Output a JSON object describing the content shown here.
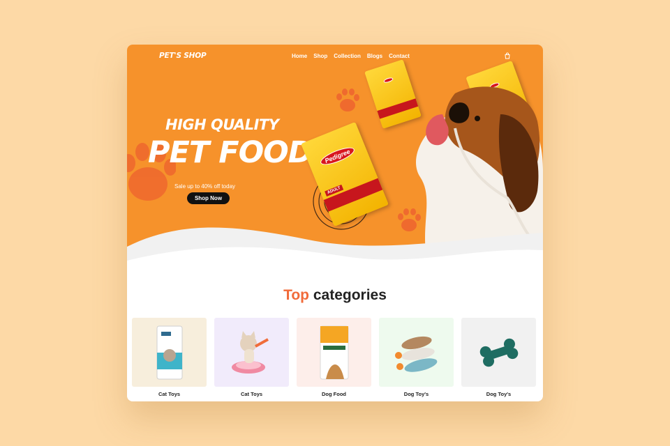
{
  "header": {
    "logo": "PET'S SHOP",
    "nav": [
      "Home",
      "Shop",
      "Collection",
      "Blogs",
      "Contact"
    ],
    "cart_icon": "bag-icon"
  },
  "hero": {
    "headline_top": "HIGH QUALITY",
    "headline_main": "PET FOOD",
    "subline": "Sale up to 40% off today",
    "cta": "Shop Now",
    "bag_brand": "Pedigree",
    "bag_label": "ADULT"
  },
  "categories": {
    "title_accent": "Top",
    "title_rest": "categories",
    "items": [
      {
        "label": "Cat Toys",
        "bg": "#f7eedc",
        "icon": "cat-food-bag"
      },
      {
        "label": "Cat Toys",
        "bg": "#f1ebfb",
        "icon": "kitten-toy"
      },
      {
        "label": "Dog Food",
        "bg": "#fdeeea",
        "icon": "dog-food-bag"
      },
      {
        "label": "Dog Toy's",
        "bg": "#eefaee",
        "icon": "plush-duck-toys"
      },
      {
        "label": "Dog Toy's",
        "bg": "#f1f1f1",
        "icon": "bone-toy"
      }
    ]
  },
  "colors": {
    "background": "#fdd9a6",
    "hero": "#f6922b",
    "accent": "#f16b3a",
    "button": "#111111"
  }
}
